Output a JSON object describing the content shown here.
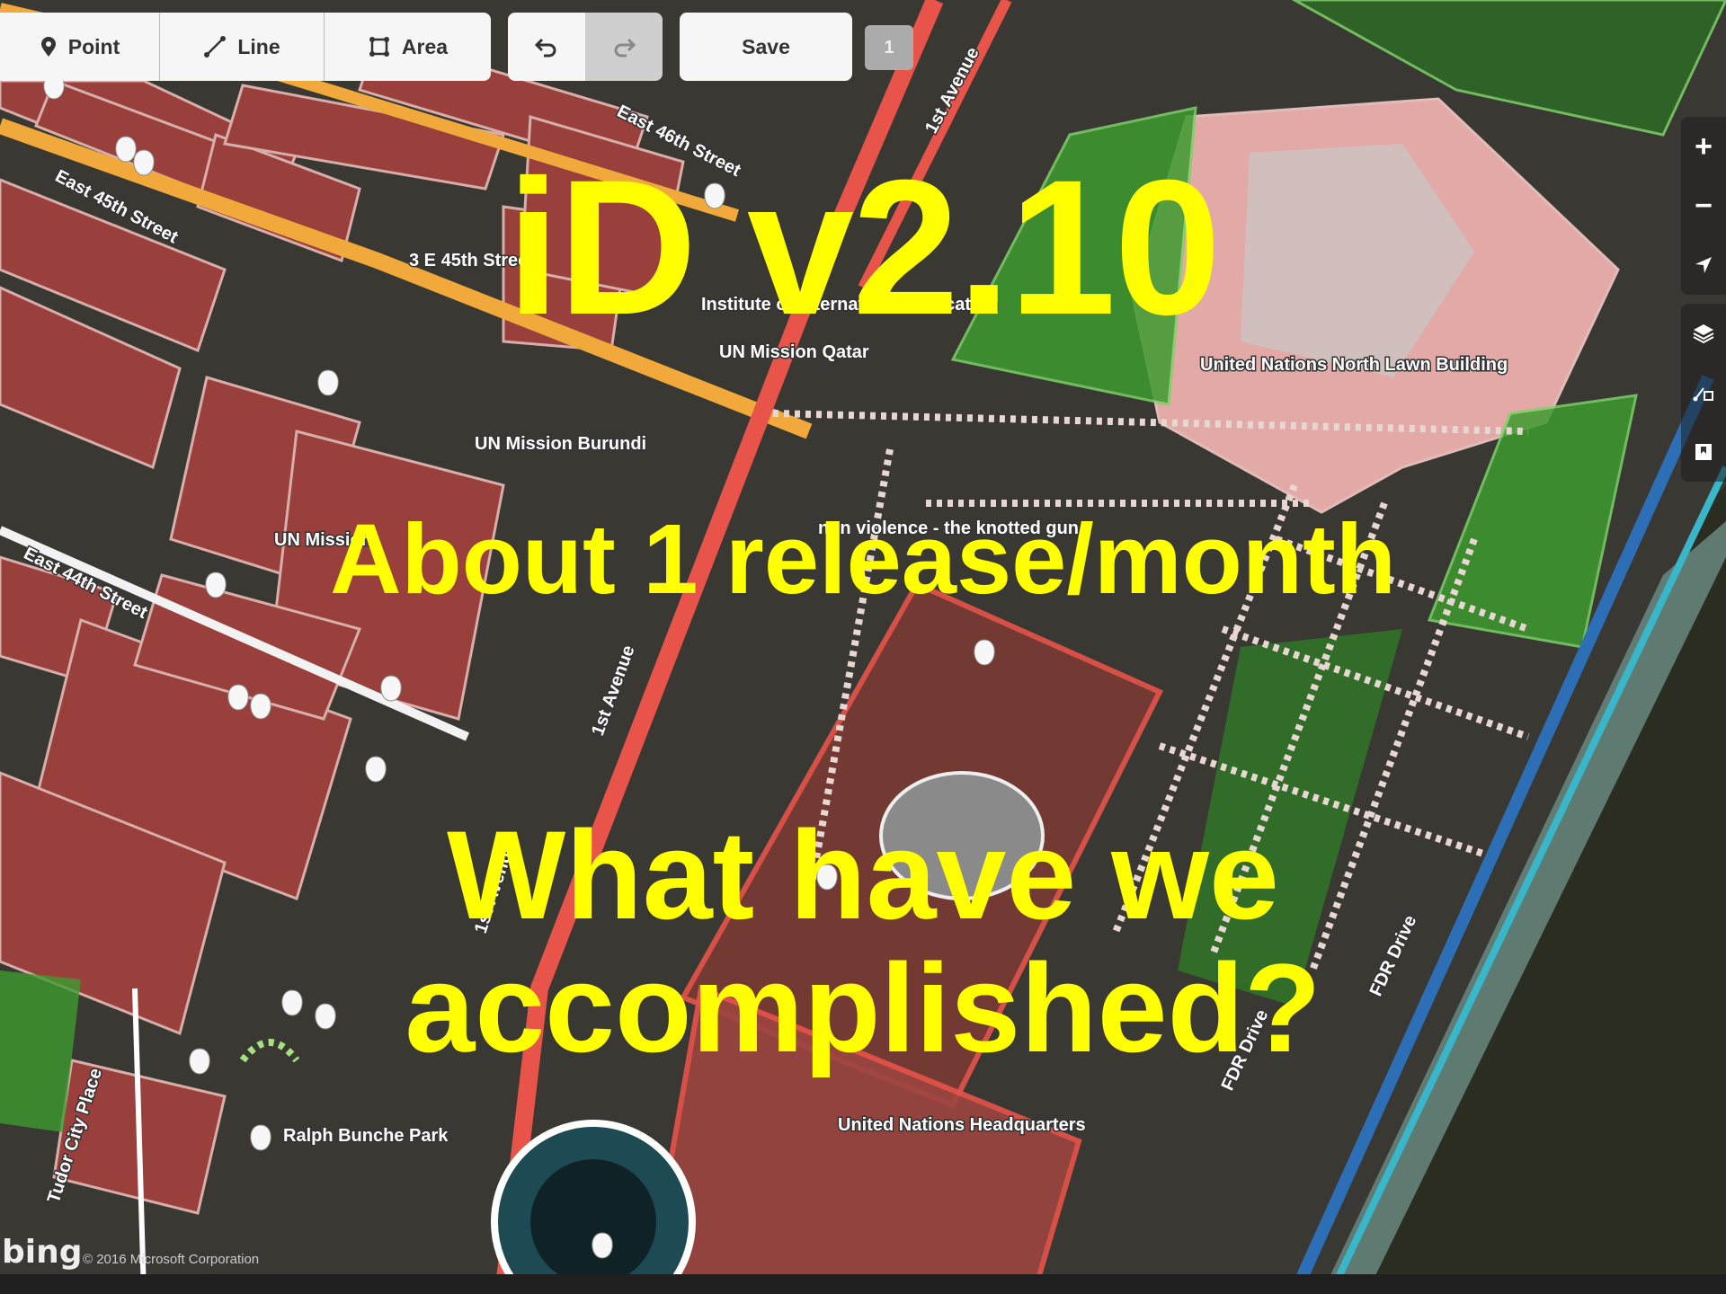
{
  "toolbar": {
    "point_label": "Point",
    "line_label": "Line",
    "area_label": "Area",
    "undo_icon": "undo-icon",
    "redo_icon": "redo-icon",
    "save_label": "Save",
    "edit_count": "1"
  },
  "controls": {
    "zoom_in": "+",
    "zoom_out": "−",
    "icons": [
      "zoom-in-icon",
      "zoom-out-icon",
      "geolocate-icon",
      "layers-icon",
      "map-data-icon",
      "help-icon"
    ]
  },
  "slide": {
    "title": "iD v2.10",
    "subtitle": "About 1 release/month",
    "question_line1": "What have we",
    "question_line2": "accomplished?"
  },
  "map_labels": {
    "street_46": "East 46th Street",
    "street_45": "East 45th Street",
    "street_44": "East 44th Street",
    "first_ave_top": "1st Avenue",
    "first_ave_mid": "1st Avenue",
    "first_ave_low": "1st Avenue",
    "poi_45th": "3 E 45th Street",
    "poi_institute": "Institute of International Education",
    "poi_qatar": "UN Mission Qatar",
    "poi_burundi": "UN Mission Burundi",
    "poi_un": "UN Mission",
    "poi_nonviolence": "non violence - the knotted gun",
    "lawn_building": "United Nations North Lawn Building",
    "un_hq": "United Nations Headquarters",
    "ralph_bunche": "Ralph Bunche Park",
    "tudor_city": "Tudor City Place",
    "fdr_1": "FDR Drive",
    "fdr_2": "FDR Drive"
  },
  "attribution": {
    "logo": "bing",
    "copyright": "© 2016 Microsoft Corporation"
  },
  "colors": {
    "building_fill": "#a0413d",
    "building_outline": "#e8c0bc",
    "highlight_fill": "#f2b3b0",
    "road_red": "#e8534a",
    "road_orange": "#f0a93a",
    "park_green": "#3e8f2e",
    "water": "#2c2f22",
    "overlay_text": "#ffff00"
  }
}
